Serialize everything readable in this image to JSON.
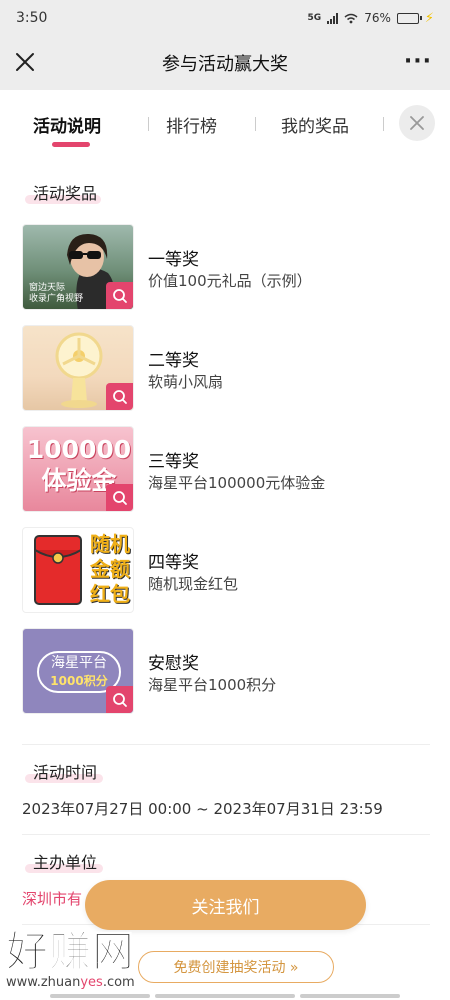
{
  "status_bar": {
    "time": "3:50",
    "network": "5G",
    "battery": "76%",
    "battery_level": 0.76
  },
  "navbar": {
    "title": "参与活动赢大奖"
  },
  "tabs": [
    {
      "label": "活动说明",
      "active": true
    },
    {
      "label": "排行榜",
      "active": false
    },
    {
      "label": "我的奖品",
      "active": false
    }
  ],
  "prizes_section": {
    "title": "活动奖品",
    "items": [
      {
        "name": "一等奖",
        "desc": "价值100元礼品（示例）",
        "image_caption_1": "窗边天际",
        "image_caption_2": "收录广角视野"
      },
      {
        "name": "二等奖",
        "desc": "软萌小风扇"
      },
      {
        "name": "三等奖",
        "desc": "海星平台100000元体验金",
        "image_line_1": "100000",
        "image_line_2": "体验金"
      },
      {
        "name": "四等奖",
        "desc": "随机现金红包",
        "image_line_1": "随机",
        "image_line_2": "金额",
        "image_line_3": "红包"
      },
      {
        "name": "安慰奖",
        "desc": "海星平台1000积分",
        "image_line_1": "海星平台",
        "image_line_2": "1000积分"
      }
    ]
  },
  "time_section": {
    "title": "活动时间",
    "value": "2023年07月27日 00:00 ~ 2023年07月31日 23:59"
  },
  "organizer_section": {
    "title": "主办单位",
    "value": "深圳市有"
  },
  "follow_button": "关注我们",
  "create_link": "免费创建抽奖活动 »",
  "watermark": {
    "big": "好赚网",
    "small_1": "www.zhuan",
    "small_2": "yes",
    "small_3": ".com"
  },
  "colors": {
    "accent": "#e3456d",
    "button": "#e8ab62",
    "bar_bg": "#ededed"
  }
}
